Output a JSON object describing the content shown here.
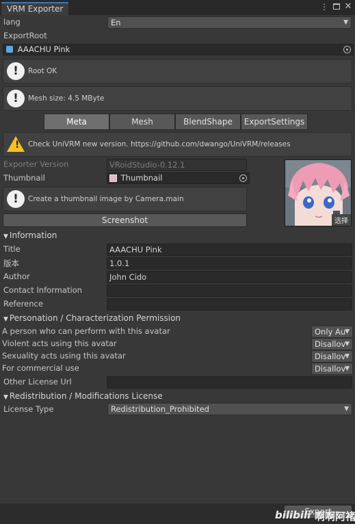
{
  "window": {
    "tab_title": "VRM Exporter",
    "menu_icon": "kebab-menu-icon",
    "maximize_icon": "maximize-icon",
    "close_icon": "close-icon"
  },
  "lang": {
    "label": "lang",
    "value": "En"
  },
  "export_root": {
    "label": "ExportRoot",
    "value": "AAACHU Pink"
  },
  "messages": {
    "root_ok": "Root OK",
    "mesh_size": "Mesh size: 4.5 MByte",
    "univrm_version": "Check UniVRM new version. https://github.com/dwango/UniVRM/releases",
    "thumbnail_hint": "Create a thumbnail image by Camera.main"
  },
  "tabs": [
    "Meta",
    "Mesh",
    "BlendShape",
    "ExportSettings"
  ],
  "meta": {
    "exporter_version_label": "Exporter Version",
    "exporter_version_value": "VRoidStudio-0.12.1",
    "thumbnail_label": "Thumbnail",
    "thumbnail_value": "Thumbnail",
    "screenshot_button": "Screenshot",
    "thumbnail_select": "选择"
  },
  "information": {
    "header": "Information",
    "fields": [
      {
        "label": "Title",
        "value": "AAACHU Pink"
      },
      {
        "label": "版本",
        "value": "1.0.1"
      },
      {
        "label": "Author",
        "value": "John Cido"
      },
      {
        "label": "Contact Information",
        "value": ""
      },
      {
        "label": "Reference",
        "value": ""
      }
    ]
  },
  "permission": {
    "header": "Personation / Characterization Permission",
    "rows": [
      {
        "label": "A person who can perform with this avatar",
        "value": "Only Au"
      },
      {
        "label": "Violent acts using this avatar",
        "value": "Disallov"
      },
      {
        "label": "Sexuality acts using this avatar",
        "value": "Disallov"
      },
      {
        "label": "For commercial use",
        "value": "Disallov"
      }
    ],
    "other_license_label": "Other License Url",
    "other_license_value": ""
  },
  "redistribution": {
    "header": "Redistribution / Modifications License",
    "license_type_label": "License Type",
    "license_type_value": "Redistribution_Prohibited"
  },
  "export_button": "Export",
  "watermark": {
    "logo": "bilibili",
    "text": "啊啊阿褚"
  }
}
